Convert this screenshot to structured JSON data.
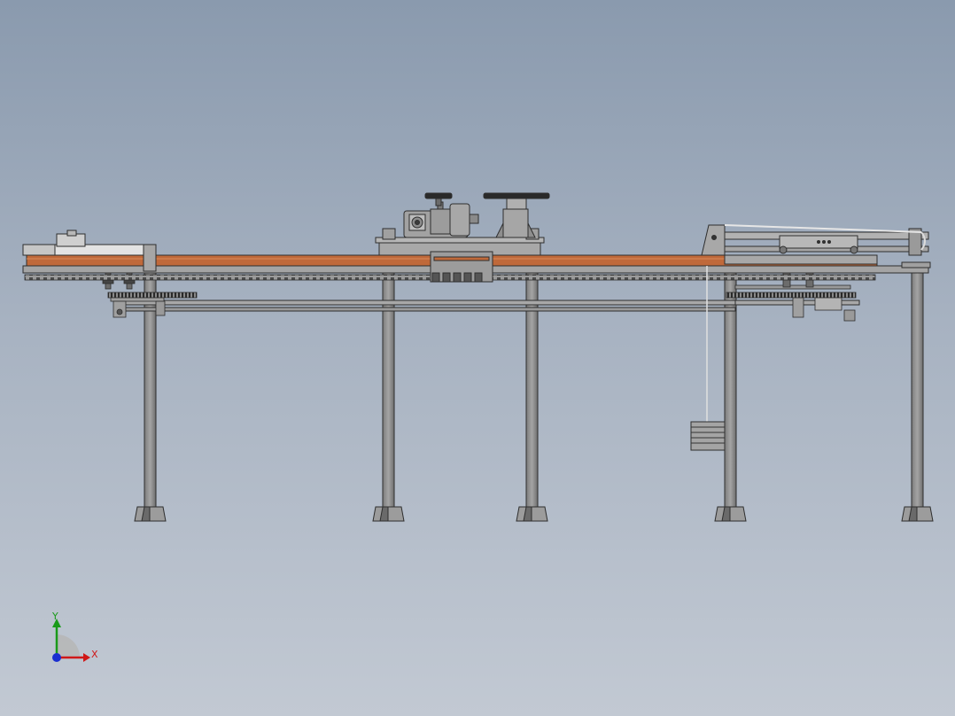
{
  "viewport": {
    "background_top": "#8a9aae",
    "background_bottom": "#c2c9d3"
  },
  "model": {
    "frame_color": "#8f8f8f",
    "outline_color": "#2e2e2e",
    "belt_color": "#c0693a",
    "chain_color": "#5a5a5a",
    "sprocket_color": "#2a2a2a",
    "housing_color": "#a3a3a3"
  },
  "triad": {
    "x_label": "X",
    "y_label": "Y",
    "x_color": "#d01818",
    "y_color": "#1a9a1a",
    "z_color": "#1a2fd0"
  }
}
